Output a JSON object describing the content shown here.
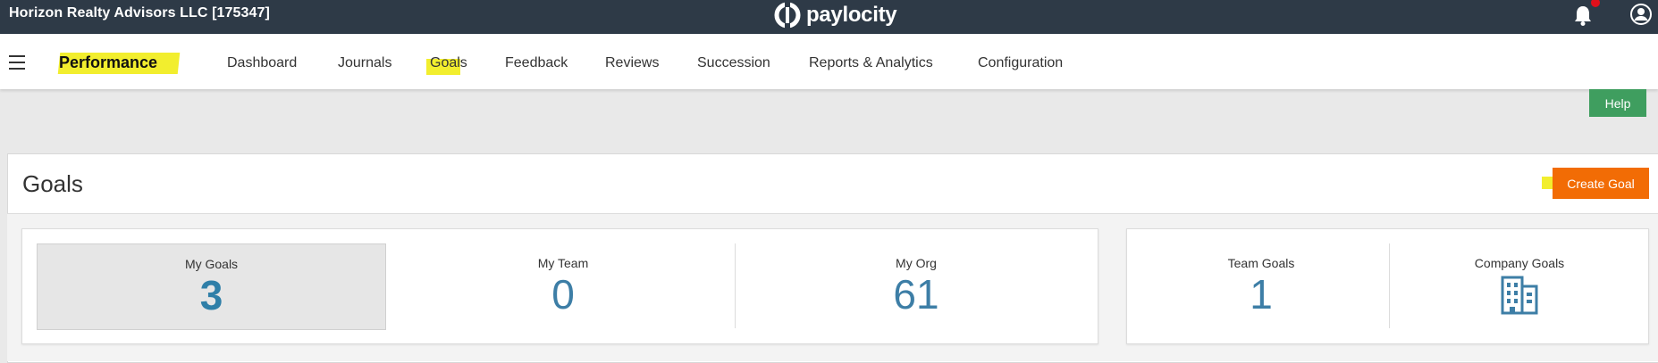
{
  "topbar": {
    "company": "Horizon Realty Advisors LLC [175347]",
    "logo_text": "paylocity"
  },
  "nav": {
    "title": "Performance",
    "items": [
      "Dashboard",
      "Journals",
      "Goals",
      "Feedback",
      "Reviews",
      "Succession",
      "Reports & Analytics",
      "Configuration"
    ]
  },
  "help_label": "Help",
  "goals": {
    "title": "Goals",
    "create_label": "Create Goal",
    "tiles": [
      {
        "label": "My Goals",
        "value": "3"
      },
      {
        "label": "My Team",
        "value": "0"
      },
      {
        "label": "My Org",
        "value": "61"
      }
    ],
    "right_tiles": [
      {
        "label": "Team Goals",
        "value": "1"
      },
      {
        "label": "Company Goals",
        "icon": "building-icon"
      }
    ]
  },
  "colors": {
    "topbar": "#2e3a47",
    "help": "#3f9e5f",
    "create": "#f26c05",
    "value": "#3d7ea6",
    "highlight": "#f2ee2e"
  }
}
